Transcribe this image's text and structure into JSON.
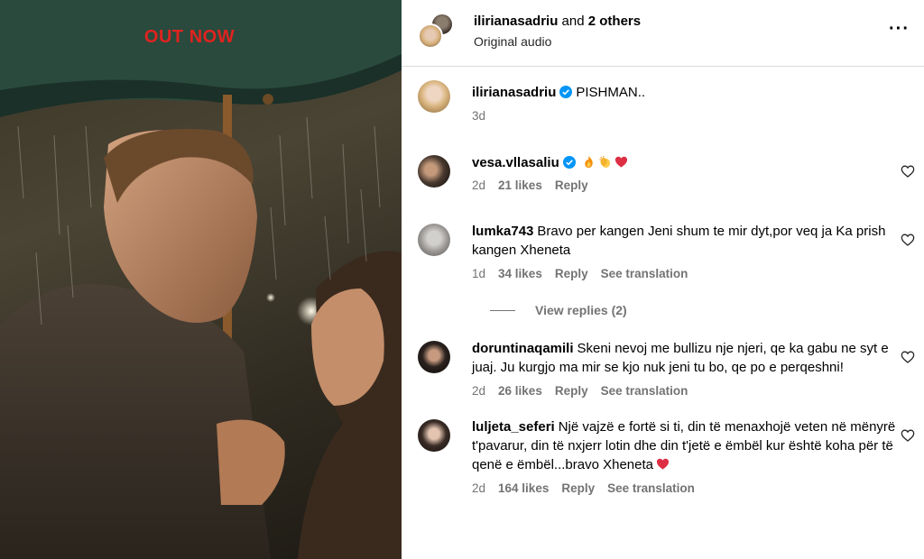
{
  "media": {
    "overlay_text": "OUT NOW"
  },
  "header": {
    "username": "ilirianasadriu",
    "and_text": "and",
    "others_text": "2 others",
    "audio": "Original audio",
    "more_icon": "more-horizontal-icon"
  },
  "caption": {
    "username": "ilirianasadriu",
    "text": "PISHMAN..",
    "time": "3d"
  },
  "comments": [
    {
      "username": "vesa.vllasaliu",
      "verified": true,
      "text": "",
      "emojis": [
        "fire",
        "clap",
        "red-heart"
      ],
      "time": "2d",
      "likes": "21 likes",
      "reply": "Reply",
      "translation": ""
    },
    {
      "username": "lumka743",
      "text": "Bravo per kangen Jeni shum te mir dyt,por veq ja Ka prish kangen Xheneta",
      "time": "1d",
      "likes": "34 likes",
      "reply": "Reply",
      "translation": "See translation",
      "view_replies": "View replies (2)"
    },
    {
      "username": "doruntinaqamili",
      "text": "Skeni nevoj me bullizu nje njeri, qe ka gabu ne syt e juaj. Ju kurgjo ma mir se kjo nuk jeni tu bo, qe po e perqeshni!",
      "time": "2d",
      "likes": "26 likes",
      "reply": "Reply",
      "translation": "See translation"
    },
    {
      "username": "luljeta_seferi",
      "text": "Një vajzë e fortë si ti, din të menaxhojë veten në mënyrë t'pavarur, din të nxjerr lotin dhe din t'jetë e ëmbël kur është koha për të qenë e ëmbël...bravo Xheneta",
      "emojis": [
        "red-heart"
      ],
      "time": "2d",
      "likes": "164 likes",
      "reply": "Reply",
      "translation": "See translation"
    }
  ],
  "colors": {
    "overlay_text": "#e0231f",
    "verified": "#0095f6",
    "meta": "#737373",
    "divider": "#dbdbdb"
  }
}
